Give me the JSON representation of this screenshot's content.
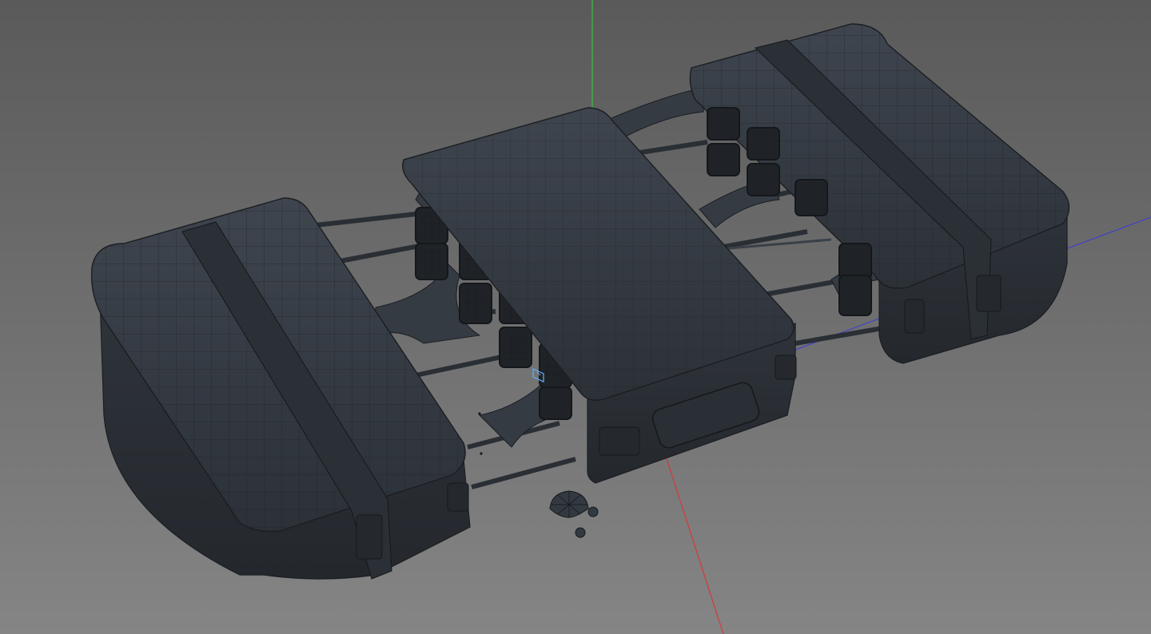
{
  "viewport": {
    "background_top": "#5a5a5a",
    "background_bottom": "#858585"
  },
  "axes": {
    "x_color": "#d23a3a",
    "y_color": "#3fbf3f",
    "z_color": "#3b3bd6"
  },
  "model": {
    "shell_color": "#323840",
    "shell_light": "#3c434c",
    "wire_color": "#1b1e22",
    "selection_color": "#5fb0ff",
    "parts": [
      "left-case",
      "center-case",
      "right-case",
      "rods",
      "detached-parts"
    ]
  }
}
